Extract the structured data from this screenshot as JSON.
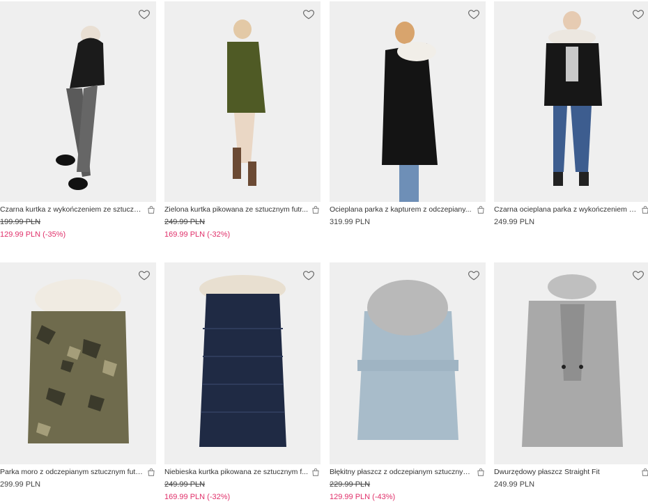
{
  "products": [
    {
      "title": "Czarna kurtka z wykończeniem ze sztuczne...",
      "old_price": "199.99 PLN",
      "price": "129.99 PLN (-35%)",
      "sale": true
    },
    {
      "title": "Zielona kurtka pikowana ze sztucznym futr...",
      "old_price": "249.99 PLN",
      "price": "169.99 PLN (-32%)",
      "sale": true
    },
    {
      "title": "Ocieplana parka z kapturem z odczepiany...",
      "old_price": "",
      "price": "319.99 PLN",
      "sale": false
    },
    {
      "title": "Czarna ocieplana parka z wykończeniem z...",
      "old_price": "",
      "price": "249.99 PLN",
      "sale": false
    },
    {
      "title": "Parka moro z odczepianym sztucznym fute...",
      "old_price": "",
      "price": "299.99 PLN",
      "sale": false
    },
    {
      "title": "Niebieska kurtka pikowana ze sztucznym f...",
      "old_price": "249.99 PLN",
      "price": "169.99 PLN (-32%)",
      "sale": true
    },
    {
      "title": "Błękitny płaszcz z odczepianym sztucznym ...",
      "old_price": "229.99 PLN",
      "price": "129.99 PLN (-43%)",
      "sale": true
    },
    {
      "title": "Dwurzędowy płaszcz Straight Fit",
      "old_price": "",
      "price": "249.99 PLN",
      "sale": false
    }
  ],
  "icons": {
    "wishlist": "heart-outline-icon",
    "cart": "shopping-bag-icon"
  },
  "colors": {
    "sale_price": "#e0306a",
    "image_bg": "#efefef"
  }
}
